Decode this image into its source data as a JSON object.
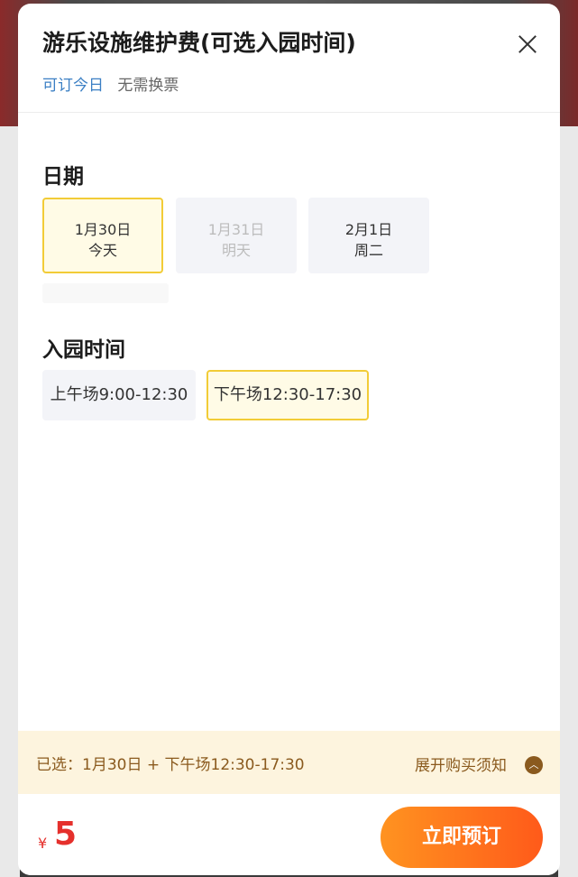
{
  "header": {
    "title": "游乐设施维护费(可选入园时间)",
    "tag_bookable": "可订今日",
    "tag_no_exchange": "无需换票"
  },
  "date_section": {
    "title": "日期",
    "dates": [
      {
        "date": "1月30日",
        "day": "今天",
        "state": "selected"
      },
      {
        "date": "1月31日",
        "day": "明天",
        "state": "disabled"
      },
      {
        "date": "2月1日",
        "day": "周二",
        "state": "available"
      }
    ]
  },
  "time_section": {
    "title": "入园时间",
    "slots": [
      {
        "label": "上午场9:00-12:30",
        "state": "available"
      },
      {
        "label": "下午场12:30-17:30",
        "state": "selected"
      }
    ]
  },
  "summary": {
    "selected_text": "已选：1月30日 + 下午场12:30-17:30",
    "expand_label": "展开购买须知",
    "expand_icon": "chevron-up-icon"
  },
  "footer": {
    "currency": "¥",
    "price": "5",
    "book_label": "立即预订"
  },
  "colors": {
    "accent_yellow": "#f2cc37",
    "price_red": "#e5302c",
    "button_orange_start": "#ff9320",
    "button_orange_end": "#ff5a1a"
  }
}
